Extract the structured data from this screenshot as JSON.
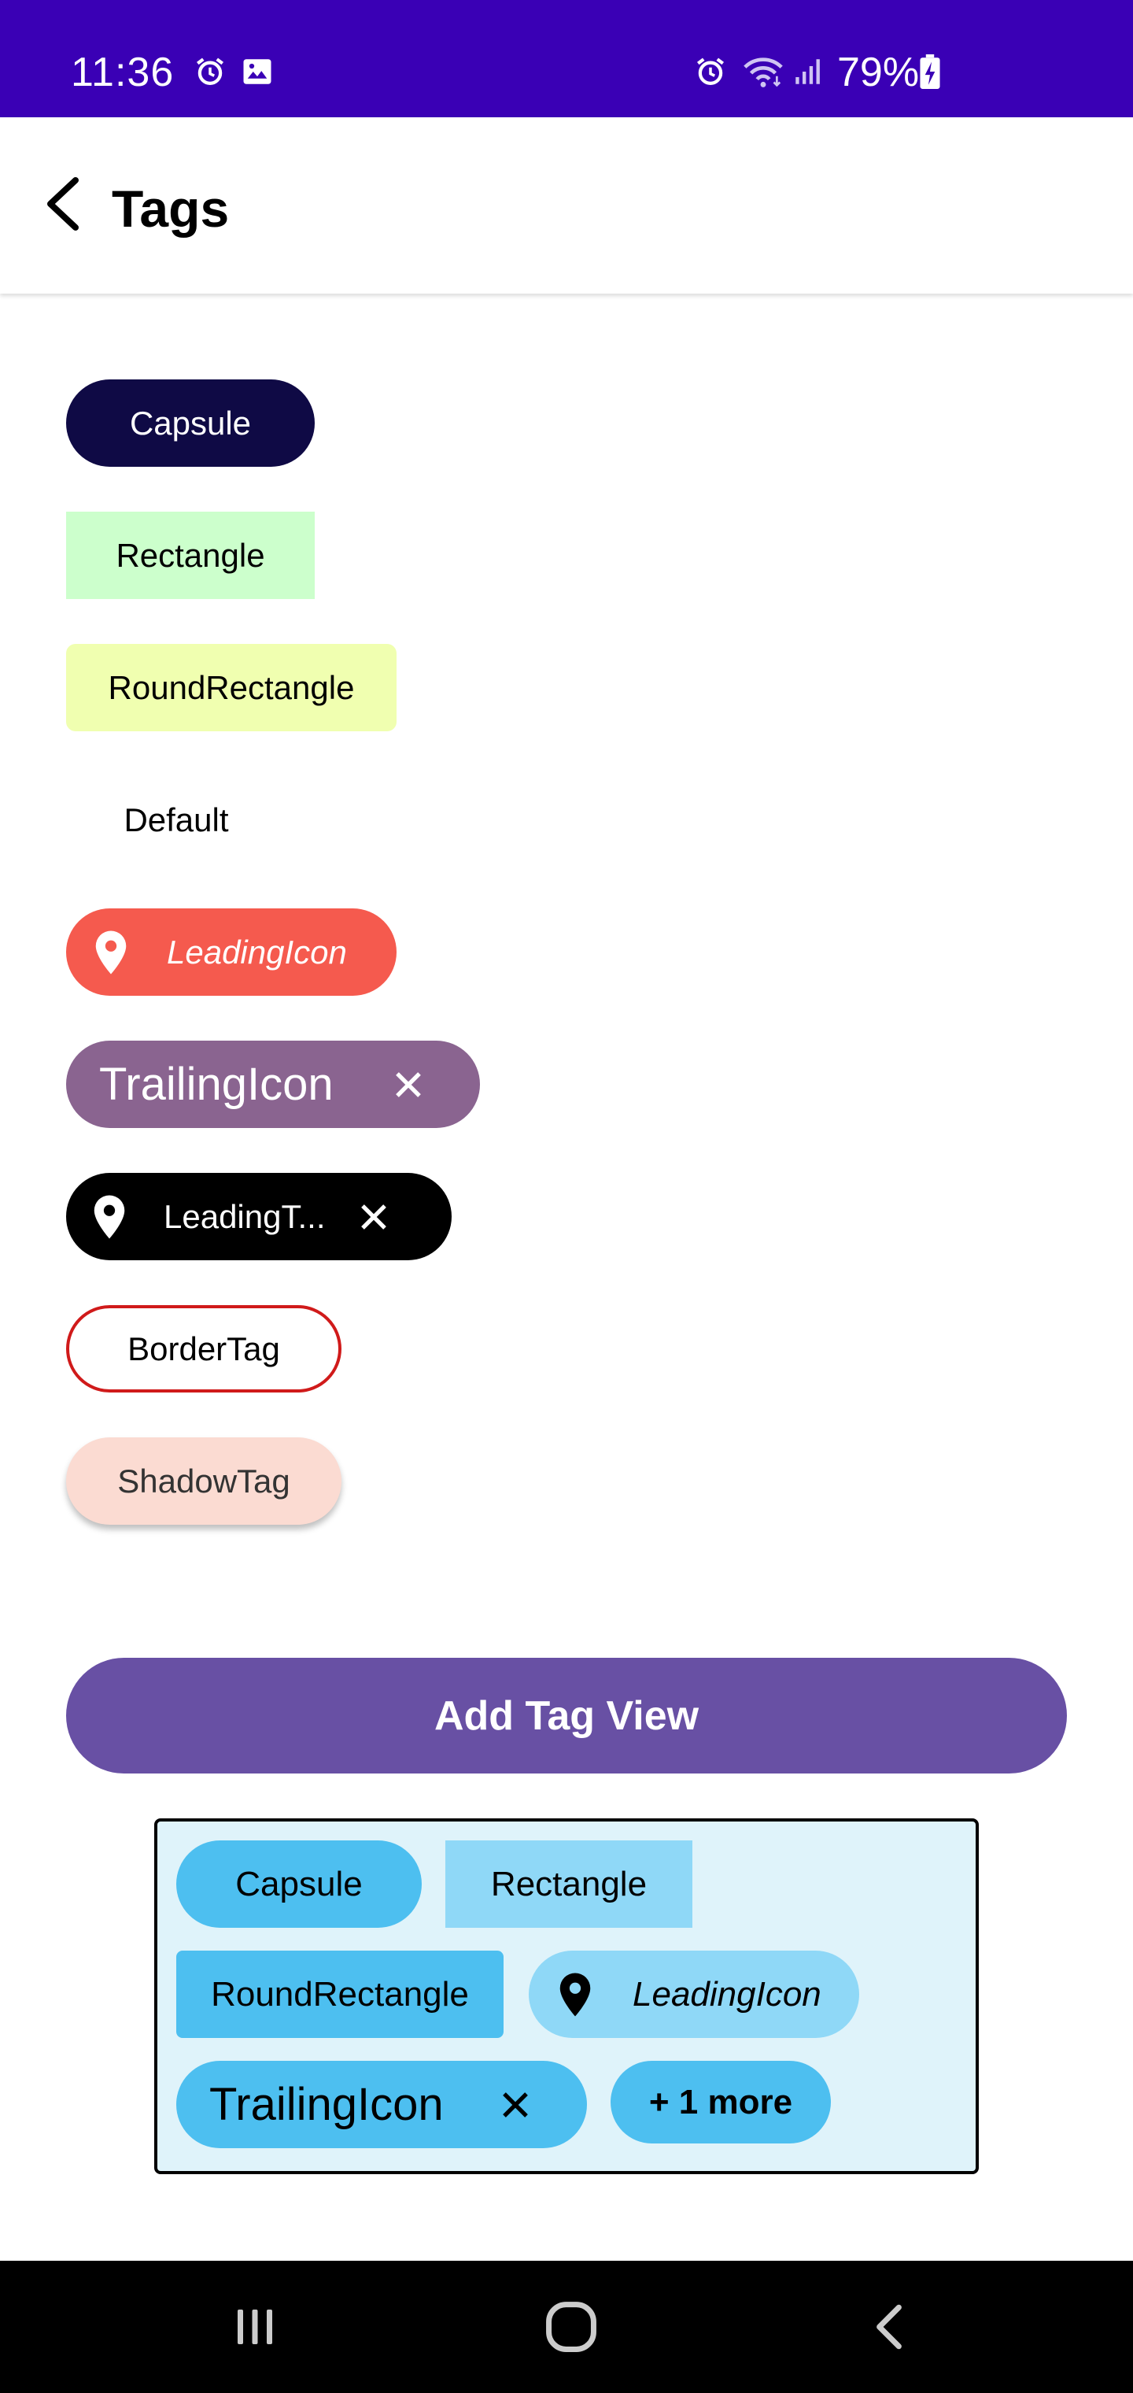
{
  "status_bar": {
    "time": "11:36",
    "battery": "79%",
    "icons": [
      "alarm-icon",
      "image-icon",
      "alarm-icon",
      "wifi-icon",
      "signal-icon",
      "battery-charging-icon"
    ]
  },
  "app_bar": {
    "title": "Tags",
    "back_icon": "back-arrow-icon"
  },
  "tags": {
    "capsule": "Capsule",
    "rectangle": "Rectangle",
    "round_rectangle": "RoundRectangle",
    "default": "Default",
    "leading_icon": "LeadingIcon",
    "trailing_icon": "TrailingIcon",
    "leading_trailing": "LeadingT...",
    "border": "BorderTag",
    "shadow": "ShadowTag"
  },
  "add_button": {
    "label": "Add Tag View"
  },
  "tag_view": {
    "items": [
      "Capsule",
      "Rectangle",
      "RoundRectangle",
      "LeadingIcon",
      "TrailingIcon"
    ],
    "more_label": "+ 1 more"
  },
  "nav_bar": {
    "icons": [
      "recents-icon",
      "home-icon",
      "back-icon"
    ]
  },
  "colors": {
    "status_bar": "#3a00b5",
    "capsule": "#0f0a45",
    "rectangle": "#ccffcc",
    "round_rectangle": "#f0ffb0",
    "leading_icon": "#f55a4e",
    "trailing_icon": "#8a6490",
    "border": "#d01a1a",
    "shadow": "#fbdbd2",
    "add_button": "#6850a4",
    "tag_view_bg": "#dff3fa",
    "tag_view_tag": "#4dbff0",
    "tag_view_tag_light": "#8fd8f7"
  }
}
